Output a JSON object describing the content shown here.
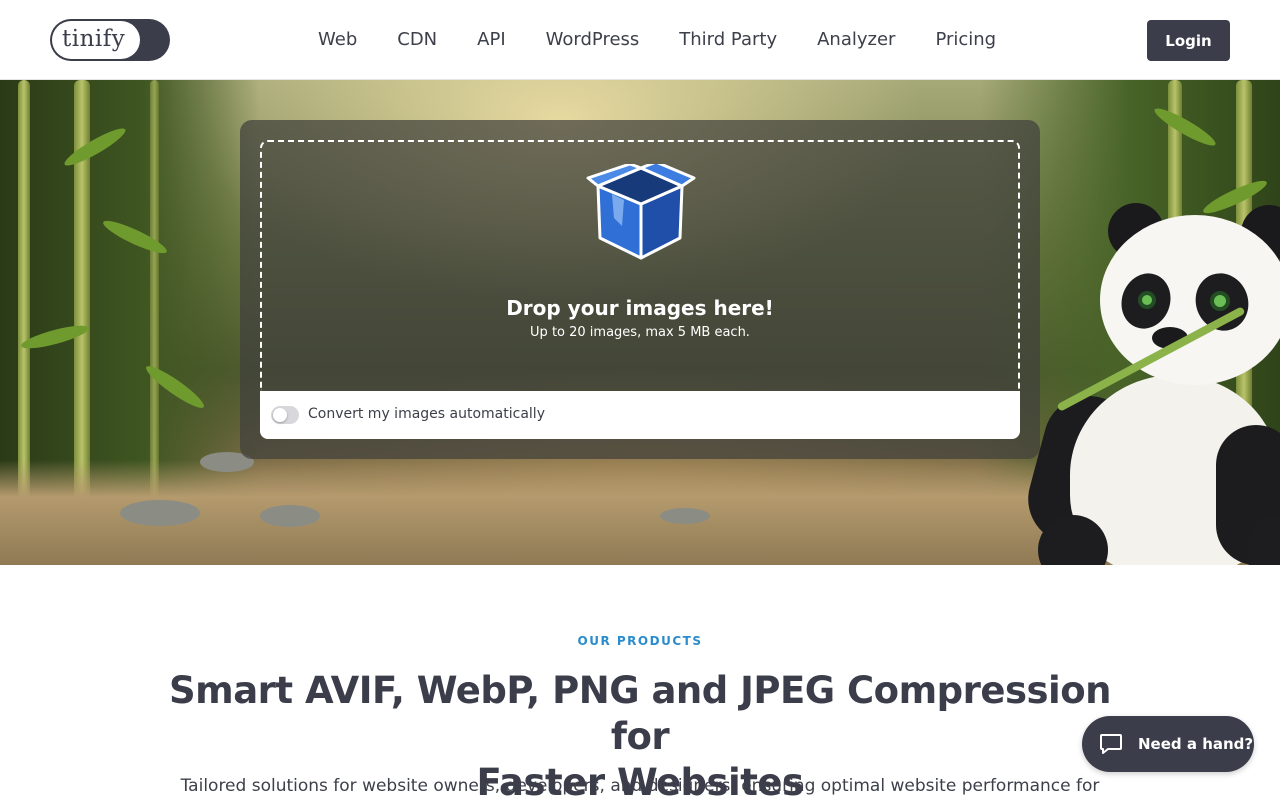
{
  "header": {
    "logo_text": "tinify",
    "nav": [
      "Web",
      "CDN",
      "API",
      "WordPress",
      "Third Party",
      "Analyzer",
      "Pricing"
    ],
    "login_label": "Login"
  },
  "hero": {
    "drop_title": "Drop your images here!",
    "drop_subtitle": "Up to 20 images, max 5 MB each.",
    "convert_label": "Convert my images automatically",
    "convert_enabled": false
  },
  "products": {
    "eyebrow": "OUR PRODUCTS",
    "headline_line1": "Smart AVIF, WebP, PNG and JPEG Compression for",
    "headline_line2": "Faster Websites",
    "lead": "Tailored solutions for website owners, developers, and designers, ensuring optimal website performance for"
  },
  "help": {
    "label": "Need a hand?",
    "icon": "chat-bubble-icon"
  },
  "colors": {
    "brand_dark": "#3b3e4a",
    "accent_blue": "#2b8ccc",
    "box_blue": "#2e6fd0"
  }
}
